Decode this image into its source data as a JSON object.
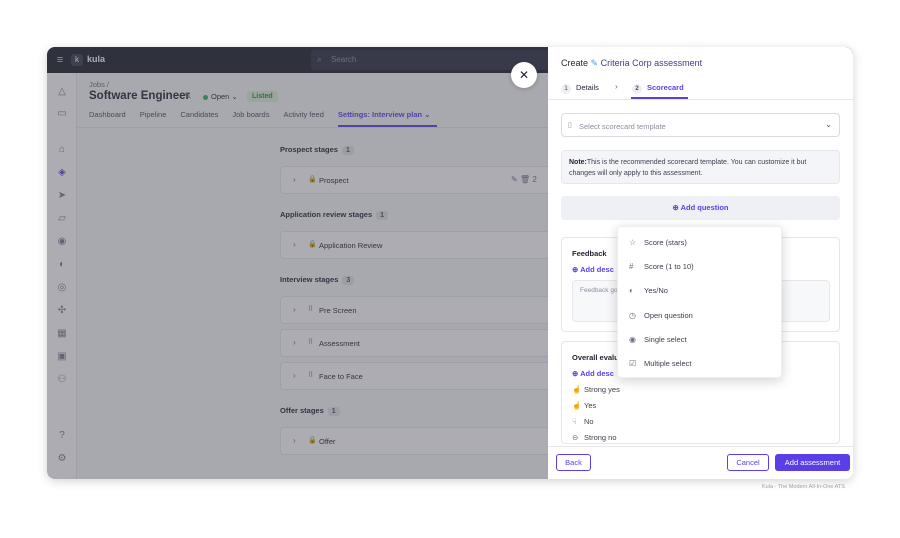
{
  "topbar": {
    "brand": "kula",
    "brand_mark": "k",
    "search_placeholder": "Search"
  },
  "breadcrumb": "Jobs /",
  "job": {
    "title": "Software Engineer",
    "status": "Open",
    "badge": "Listed"
  },
  "tabs": [
    "Dashboard",
    "Pipeline",
    "Candidates",
    "Job boards",
    "Activity feed",
    "Settings: Interview plan"
  ],
  "stages": {
    "prospect": {
      "label": "Prospect stages",
      "count": "1",
      "items": [
        "Prospect"
      ],
      "tool_extra": "2"
    },
    "application": {
      "label": "Application review stages",
      "count": "1",
      "items": [
        "Application Review"
      ]
    },
    "interview": {
      "label": "Interview stages",
      "count": "3",
      "items": [
        "Pre Screen",
        "Assessment",
        "Face to Face"
      ]
    },
    "offer": {
      "label": "Offer stages",
      "count": "1",
      "items": [
        "Offer"
      ]
    }
  },
  "drawer": {
    "title_prefix": "Create",
    "title_name": "Criteria Corp assessment",
    "steps": [
      {
        "num": "1",
        "label": "Details"
      },
      {
        "num": "2",
        "label": "Scorecard"
      }
    ],
    "template_placeholder": "Select scorecard template",
    "note_label": "Note:",
    "note_text": "This is the recommended scorecard template. You can customize it but changes will only apply to this assessment.",
    "add_question": "Add question",
    "feedback": {
      "title": "Feedback",
      "add_description": "Add desc",
      "placeholder": "Feedback go"
    },
    "overall": {
      "title": "Overall evalu",
      "add_description": "Add desc",
      "options": [
        "Strong yes",
        "Yes",
        "No",
        "Strong no"
      ]
    },
    "footer": {
      "back": "Back",
      "cancel": "Cancel",
      "add": "Add assessment"
    }
  },
  "question_types": [
    "Score (stars)",
    "Score (1 to 10)",
    "Yes/No",
    "Open question",
    "Single select",
    "Multiple select"
  ],
  "caption": "Kula - The Modern All-In-One ATS",
  "colors": {
    "accent": "#5b3fe6",
    "topbar": "#1d1f2b",
    "listed_bg": "#dff5d9",
    "open_dot": "#2eb566"
  }
}
